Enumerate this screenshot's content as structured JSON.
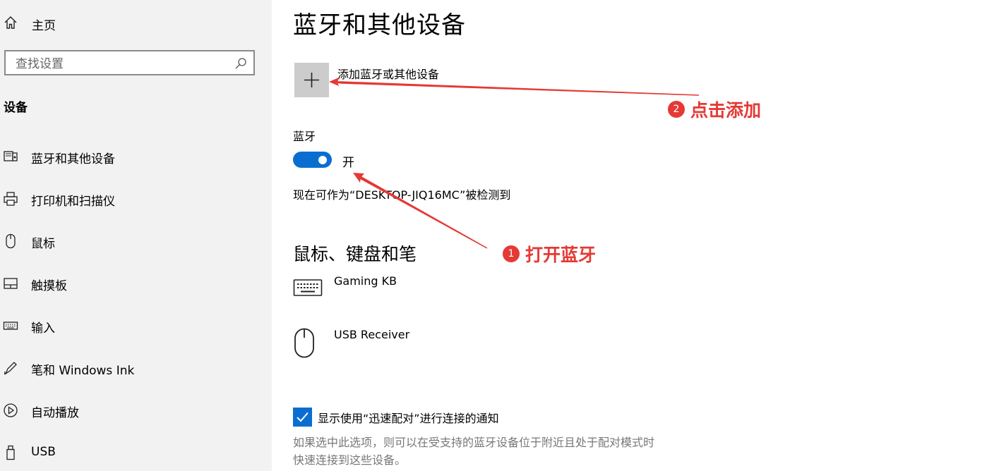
{
  "sidebar": {
    "home_label": "主页",
    "search_placeholder": "查找设置",
    "section_heading": "设备",
    "items": [
      {
        "label": "蓝牙和其他设备",
        "icon": "bluetooth-devices-icon"
      },
      {
        "label": "打印机和扫描仪",
        "icon": "printer-icon"
      },
      {
        "label": "鼠标",
        "icon": "mouse-icon"
      },
      {
        "label": "触摸板",
        "icon": "touchpad-icon"
      },
      {
        "label": "输入",
        "icon": "keyboard-icon"
      },
      {
        "label": "笔和 Windows Ink",
        "icon": "pen-icon"
      },
      {
        "label": "自动播放",
        "icon": "autoplay-icon"
      },
      {
        "label": "USB",
        "icon": "usb-icon"
      }
    ]
  },
  "main": {
    "title": "蓝牙和其他设备",
    "add_device_label": "添加蓝牙或其他设备",
    "bluetooth_heading": "蓝牙",
    "bluetooth_state": "开",
    "bluetooth_on": true,
    "discoverable_text": "现在可作为“DESKTOP-JIQ16MC”被检测到",
    "input_section_heading": "鼠标、键盘和笔",
    "devices": [
      {
        "name": "Gaming KB",
        "icon": "keyboard-icon"
      },
      {
        "name": "USB Receiver",
        "icon": "mouse-icon"
      }
    ],
    "swift_pair_label": "显示使用“迅速配对”进行连接的通知",
    "swift_pair_checked": true,
    "swift_pair_description_line1": "如果选中此选项，则可以在受支持的蓝牙设备位于附近且处于配对模式时",
    "swift_pair_description_line2": "快速连接到这些设备。"
  },
  "annotations": [
    {
      "number": "1",
      "text": "打开蓝牙"
    },
    {
      "number": "2",
      "text": "点击添加"
    }
  ],
  "colors": {
    "accent": "#0a6ed1",
    "sidebar_bg": "#f2f2f2",
    "annotation_red": "#e53935",
    "tile_gray": "#cccccc"
  }
}
